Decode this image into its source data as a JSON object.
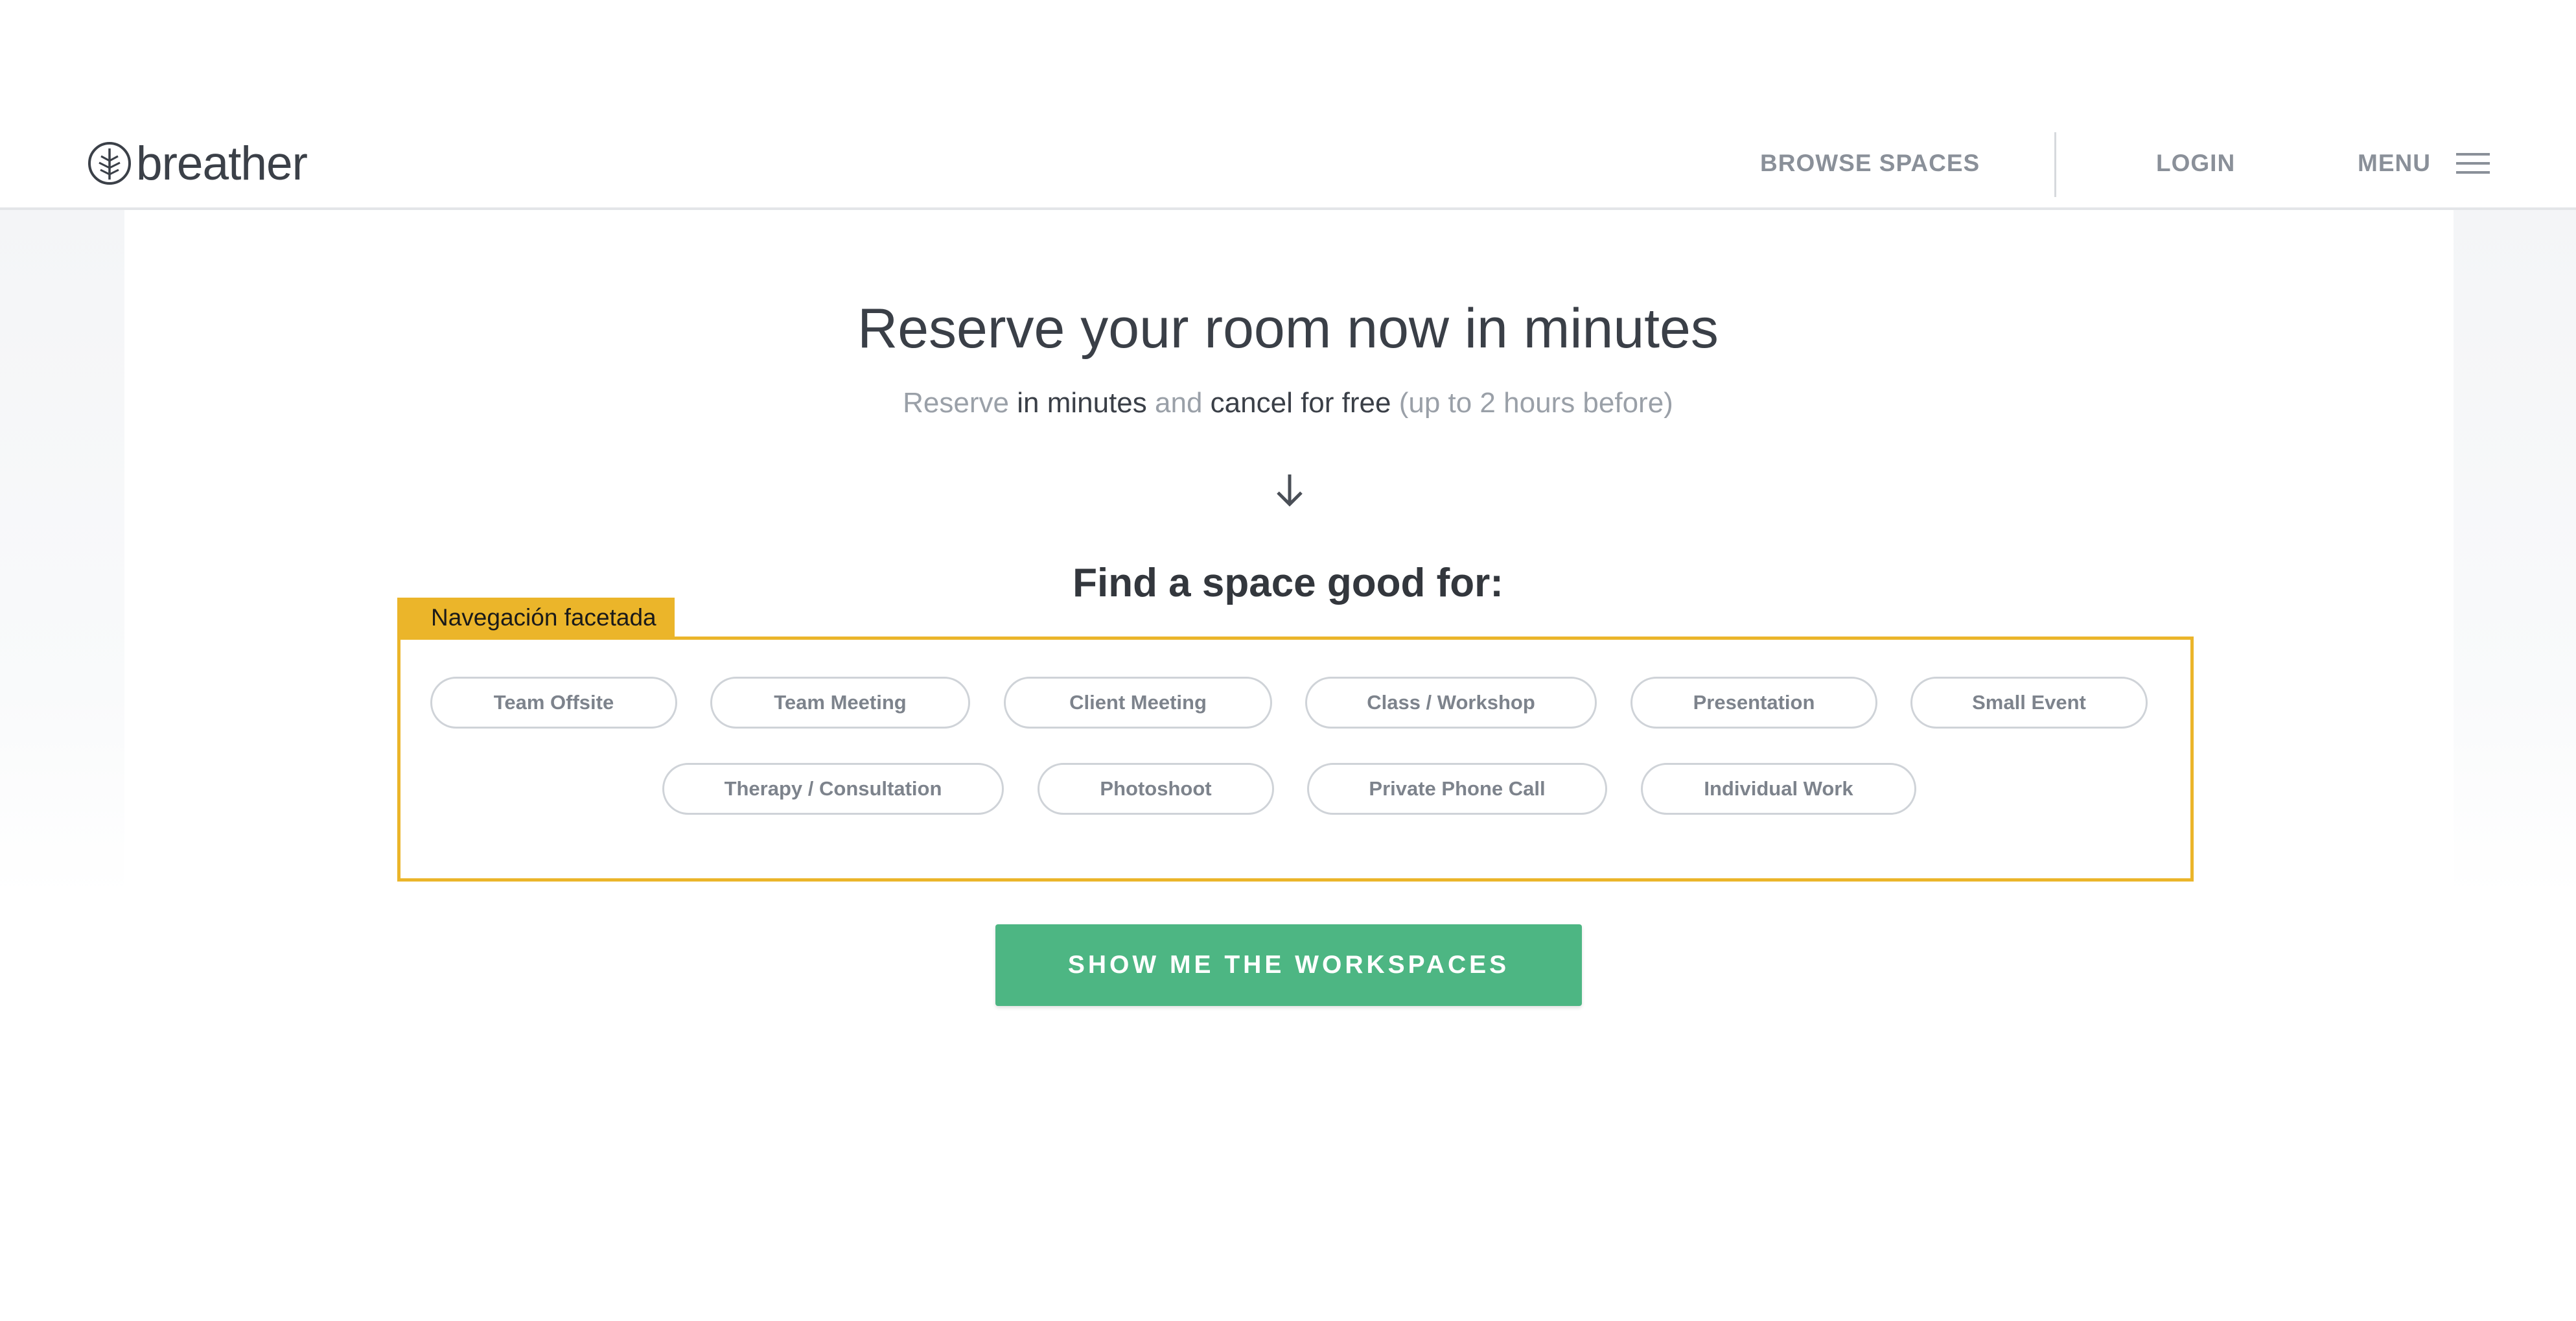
{
  "header": {
    "brand": "breather",
    "nav": {
      "browse": "BROWSE SPACES",
      "login": "LOGIN",
      "menu": "MENU"
    },
    "icons": [
      "breather-logo-icon",
      "hamburger-menu-icon"
    ]
  },
  "hero": {
    "title": "Reserve your room now in minutes",
    "subtitle": {
      "part1": "Reserve ",
      "part2": "in minutes",
      "part3": " and ",
      "part4": "cancel for free",
      "part5": " (up to 2 hours before)"
    },
    "arrow_icon": "arrow-down-icon"
  },
  "finder": {
    "title": "Find a space good for:",
    "annotation_label": "Navegación facetada",
    "chips_row1": [
      "Team Offsite",
      "Team Meeting",
      "Client Meeting",
      "Class / Workshop",
      "Presentation",
      "Small Event"
    ],
    "chips_row2": [
      "Therapy / Consultation",
      "Photoshoot",
      "Private Phone Call",
      "Individual Work"
    ]
  },
  "cta": {
    "label": "SHOW ME THE WORKSPACES"
  },
  "colors": {
    "accent_green": "#4db683",
    "annotation_yellow": "#ebb52a",
    "nav_gray": "#8a9099",
    "text_dark": "#3a3f47"
  }
}
